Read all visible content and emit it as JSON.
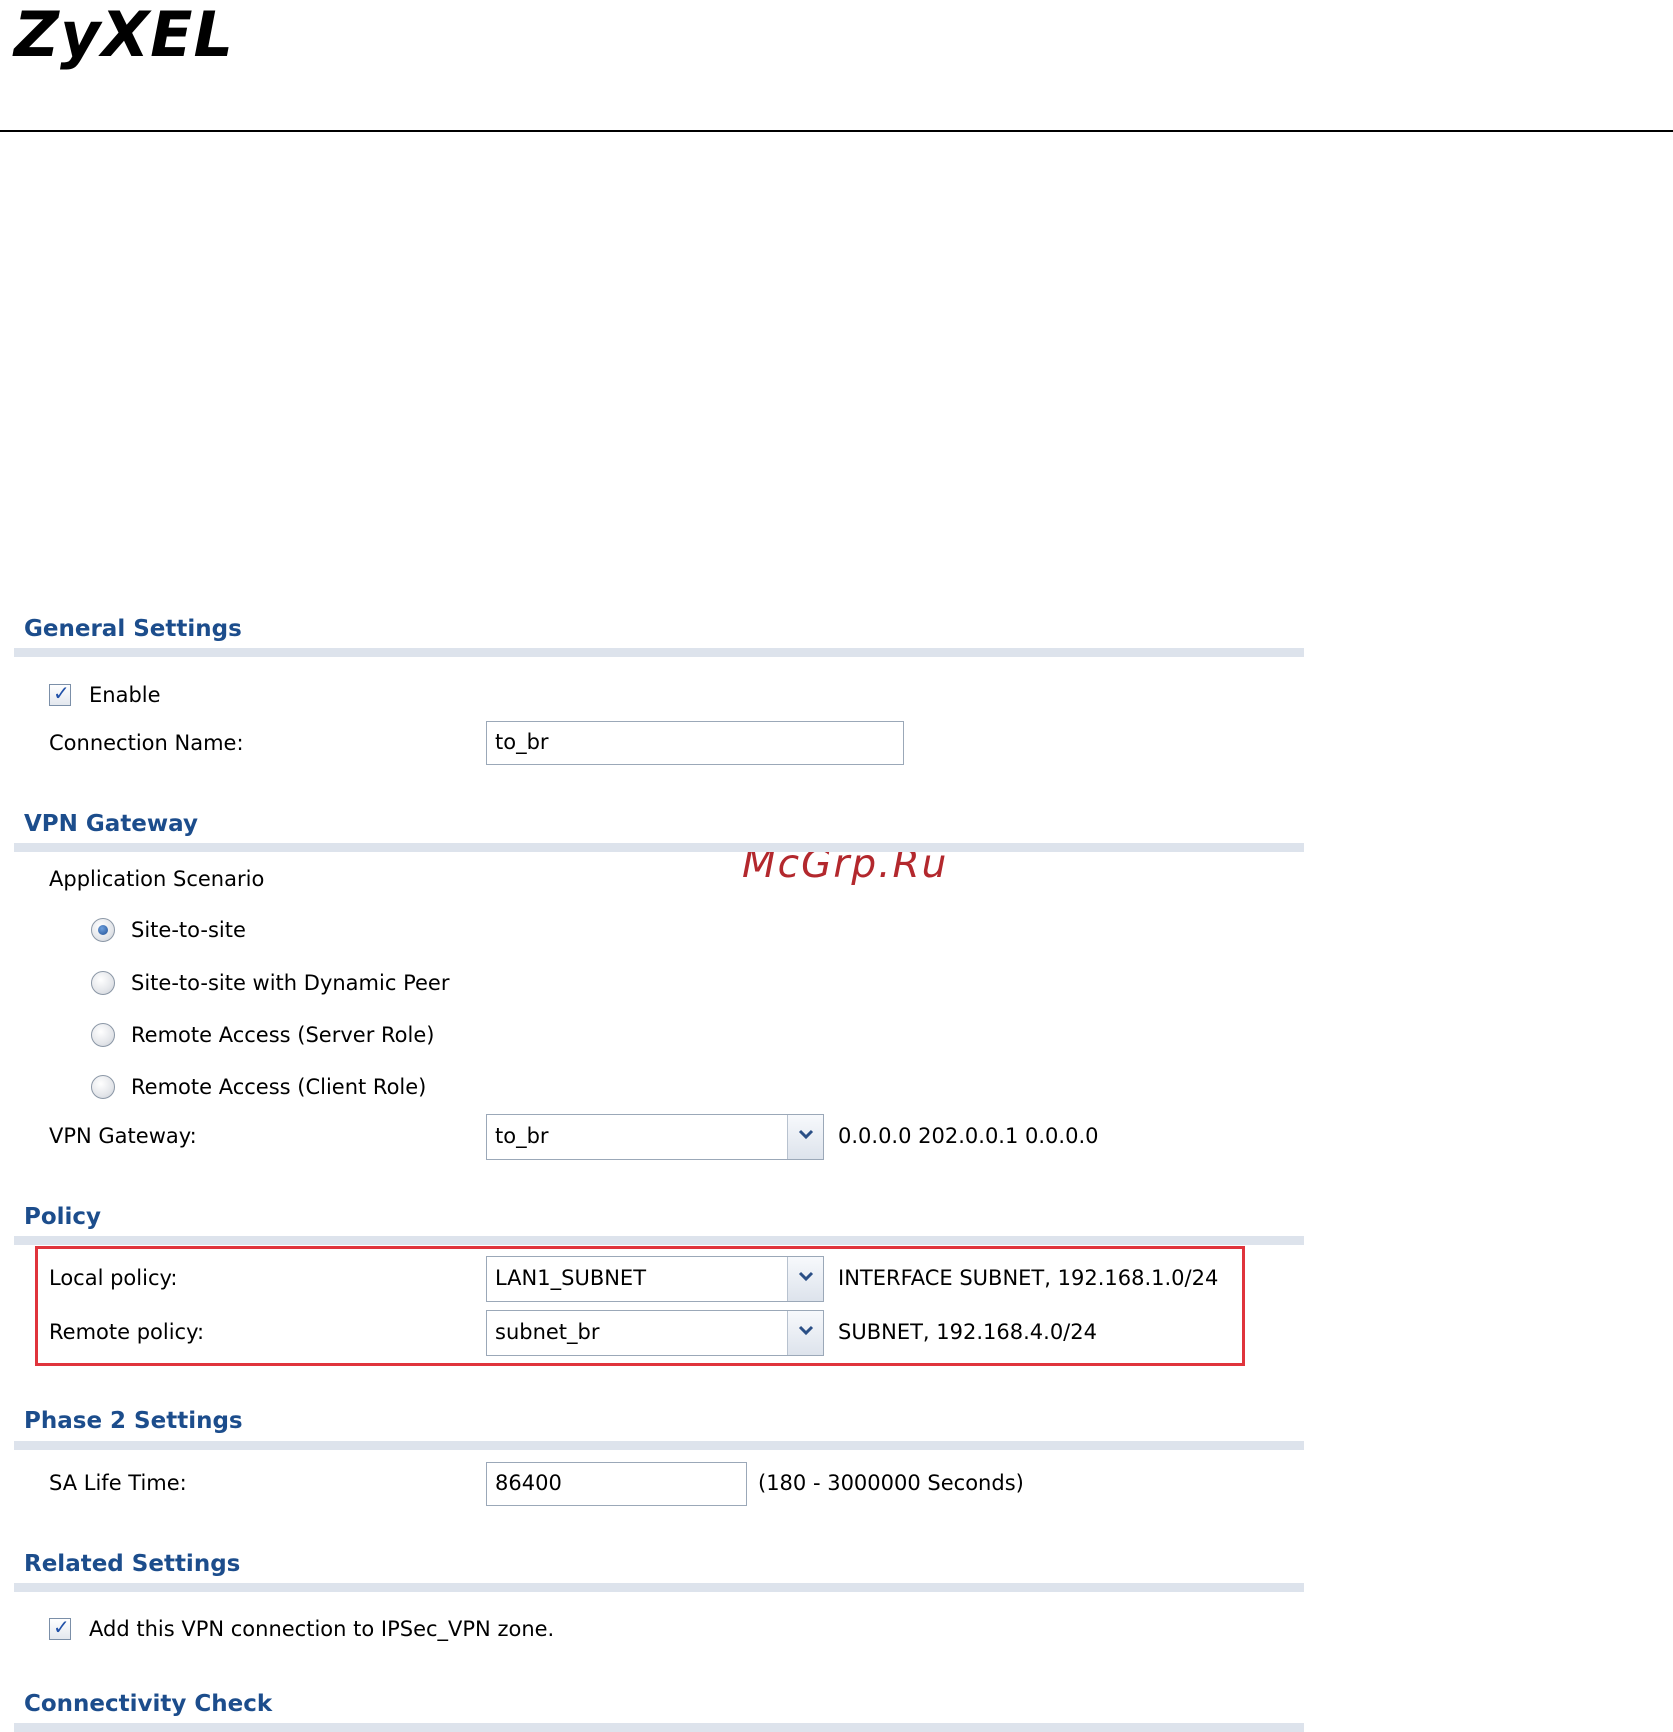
{
  "header": {
    "logo_text": "ZyXEL"
  },
  "watermark": "McGrp.Ru",
  "general_settings": {
    "title": "General Settings",
    "enable_label": "Enable",
    "enable_checked": true,
    "connection_name_label": "Connection Name:",
    "connection_name_value": "to_br"
  },
  "vpn_gateway": {
    "title": "VPN Gateway",
    "scenario_label": "Application Scenario",
    "scenarios": [
      {
        "label": "Site-to-site",
        "selected": true
      },
      {
        "label": "Site-to-site with Dynamic Peer",
        "selected": false
      },
      {
        "label": "Remote Access (Server Role)",
        "selected": false
      },
      {
        "label": "Remote Access (Client Role)",
        "selected": false
      }
    ],
    "gateway_label": "VPN Gateway:",
    "gateway_value": "to_br",
    "gateway_info": "0.0.0.0 202.0.0.1 0.0.0.0"
  },
  "policy": {
    "title": "Policy",
    "local_label": "Local policy:",
    "local_value": "LAN1_SUBNET",
    "local_info": "INTERFACE SUBNET, 192.168.1.0/24",
    "remote_label": "Remote policy:",
    "remote_value": "subnet_br",
    "remote_info": "SUBNET, 192.168.4.0/24"
  },
  "phase2": {
    "title": "Phase 2 Settings",
    "sa_label": "SA Life Time:",
    "sa_value": "86400",
    "sa_range": "(180 - 3000000 Seconds)"
  },
  "related": {
    "title": "Related Settings",
    "zone_label": "Add this VPN connection to IPSec_VPN zone.",
    "zone_checked": true
  },
  "connectivity": {
    "title": "Connectivity Check"
  },
  "colors": {
    "section_title": "#1c4d8c",
    "section_rule": "#dde3ec",
    "highlight": "#e0343c",
    "watermark": "#b3282d"
  }
}
